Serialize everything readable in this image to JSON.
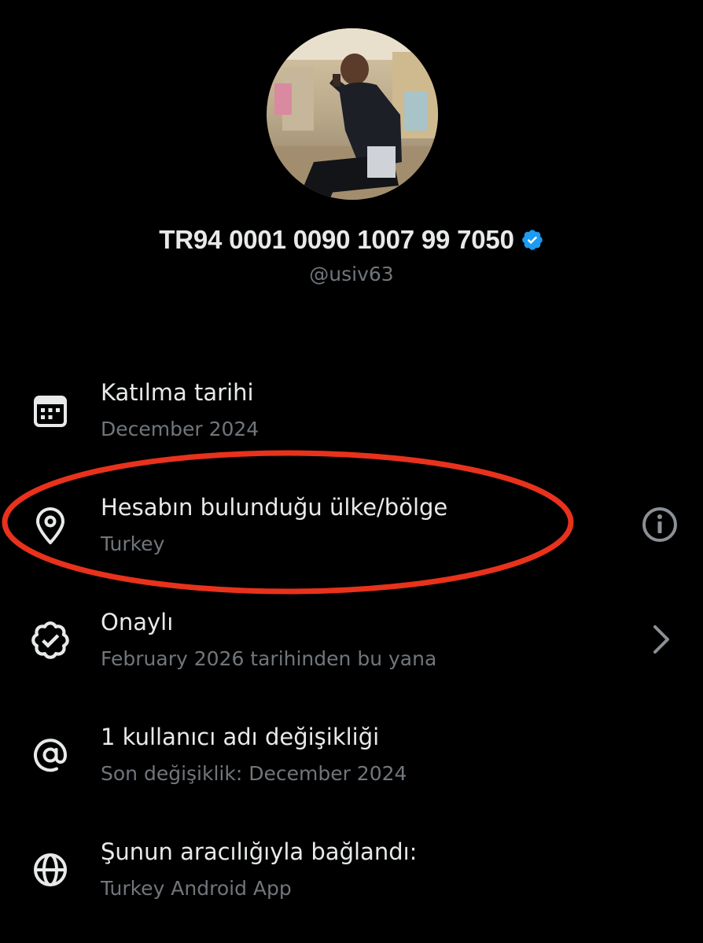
{
  "profile": {
    "display_name": "TR94 0001 0090 1007 99 7050",
    "handle": "@usiv63",
    "verified": true
  },
  "info_rows": [
    {
      "icon": "calendar-icon",
      "title": "Katılma tarihi",
      "subtitle": "December 2024"
    },
    {
      "icon": "location-pin-icon",
      "title": "Hesabın bulunduğu ülke/bölge",
      "subtitle": "Turkey",
      "trailing": "info-icon"
    },
    {
      "icon": "verified-badge-icon",
      "title": "Onaylı",
      "subtitle": "February 2026 tarihinden bu yana",
      "trailing": "chevron-right-icon"
    },
    {
      "icon": "at-sign-icon",
      "title": "1 kullanıcı adı değişikliği",
      "subtitle": "Son değişiklik: December 2024"
    },
    {
      "icon": "globe-icon",
      "title": "Şunun aracılığıyla bağlandı:",
      "subtitle": "Turkey Android App"
    }
  ],
  "colors": {
    "background": "#000000",
    "primary_text": "#e7e9ea",
    "secondary_text": "#71767b",
    "verified_blue": "#1d9bf0",
    "highlight_red": "#e8321c"
  }
}
